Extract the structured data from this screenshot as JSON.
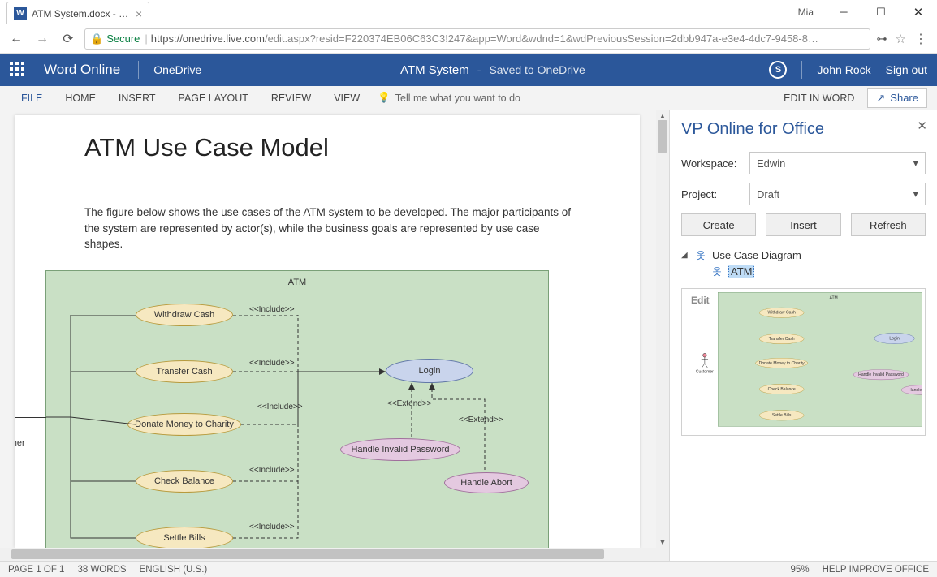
{
  "window": {
    "user": "Mia"
  },
  "browser": {
    "tab_title": "ATM System.docx - Micr…",
    "secure_label": "Secure",
    "url_host": "https://onedrive.live.com",
    "url_rest": "/edit.aspx?resid=F220374EB06C63C3!247&app=Word&wdnd=1&wdPreviousSession=2dbb947a-e3e4-4dc7-9458-8…"
  },
  "wo_header": {
    "brand": "Word Online",
    "sub": "OneDrive",
    "doc_title": "ATM System",
    "saved": "Saved to OneDrive",
    "user": "John Rock",
    "signout": "Sign out"
  },
  "ribbon": {
    "file": "FILE",
    "home": "HOME",
    "insert": "INSERT",
    "page_layout": "PAGE LAYOUT",
    "review": "REVIEW",
    "view": "VIEW",
    "tellme": "Tell me what you want to do",
    "edit_in_word": "EDIT IN WORD",
    "share": "Share"
  },
  "document": {
    "title": "ATM Use Case Model",
    "body": "The figure below shows the use cases of the ATM system to be developed. The major participants of the system are represented by actor(s), while the business goals are represented by use case shapes.",
    "diagram": {
      "frame_label": "ATM",
      "actor": "Customer",
      "usecases_yellow": [
        "Withdraw Cash",
        "Transfer Cash",
        "Donate Money to Charity",
        "Check Balance",
        "Settle Bills"
      ],
      "usecase_login": "Login",
      "usecase_hip": "Handle Invalid Password",
      "usecase_abort": "Handle Abort",
      "include": "<<Include>>",
      "extend": "<<Extend>>"
    }
  },
  "panel": {
    "title": "VP Online for Office",
    "workspace_label": "Workspace:",
    "project_label": "Project:",
    "workspace": "Edwin",
    "project": "Draft",
    "create": "Create",
    "insert": "Insert",
    "refresh": "Refresh",
    "tree_root": "Use Case Diagram",
    "tree_child": "ATM",
    "edit": "Edit"
  },
  "status": {
    "page": "PAGE 1 OF 1",
    "words": "38 WORDS",
    "lang": "ENGLISH (U.S.)",
    "zoom": "95%",
    "help": "HELP IMPROVE OFFICE"
  }
}
